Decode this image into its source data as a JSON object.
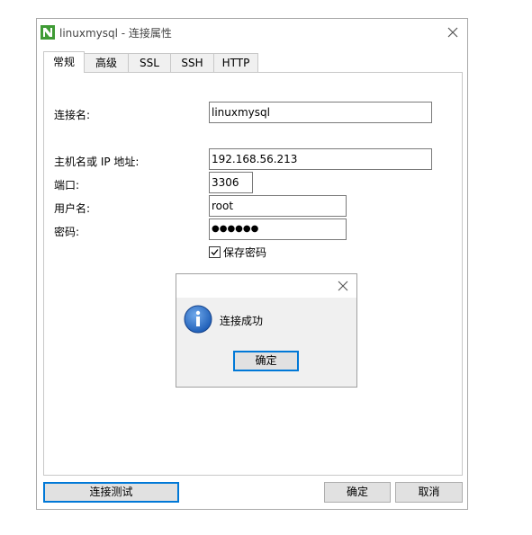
{
  "window": {
    "title": "linuxmysql - 连接属性",
    "close_glyph": "✕"
  },
  "tabs": [
    {
      "label": "常规",
      "active": true
    },
    {
      "label": "高级",
      "active": false
    },
    {
      "label": "SSL",
      "active": false
    },
    {
      "label": "SSH",
      "active": false
    },
    {
      "label": "HTTP",
      "active": false
    }
  ],
  "form": {
    "connection_name_label": "连接名:",
    "connection_name_value": "linuxmysql",
    "host_label": "主机名或 IP 地址:",
    "host_value": "192.168.56.213",
    "port_label": "端口:",
    "port_value": "3306",
    "user_label": "用户名:",
    "user_value": "root",
    "password_label": "密码:",
    "password_value": "●●●●●●",
    "save_password_label": "保存密码",
    "save_password_checked": true
  },
  "dialog": {
    "message": "连接成功",
    "ok_label": "确定",
    "icon": "info-icon"
  },
  "footer": {
    "test_label": "连接测试",
    "ok_label": "确定",
    "cancel_label": "取消"
  },
  "colors": {
    "accent": "#0078d7",
    "navicat_green": "#3f9b35",
    "info_blue": "#1f5fb8"
  }
}
